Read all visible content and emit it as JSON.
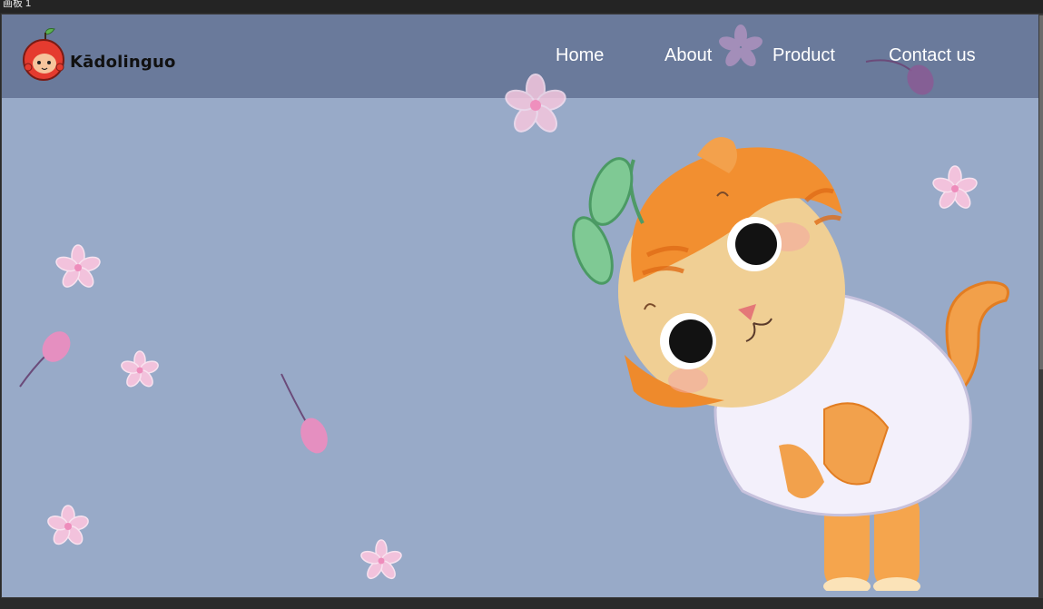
{
  "window": {
    "title": "画板 1"
  },
  "brand": {
    "name": "Kādolinguo",
    "logo_icon": "apple-mascot-icon"
  },
  "nav": {
    "items": [
      {
        "label": "Home"
      },
      {
        "label": "About"
      },
      {
        "label": "Product"
      },
      {
        "label": "Contact us"
      }
    ]
  },
  "hero": {
    "illustration": "orange-cat-with-sprout-illustration",
    "decorations": "pink-flower-icon"
  },
  "colors": {
    "nav_bg": "#6a7a9b",
    "page_bg": "#98aac8",
    "accent_orange": "#f08a2e",
    "flower_pink": "#f3b6d6"
  }
}
